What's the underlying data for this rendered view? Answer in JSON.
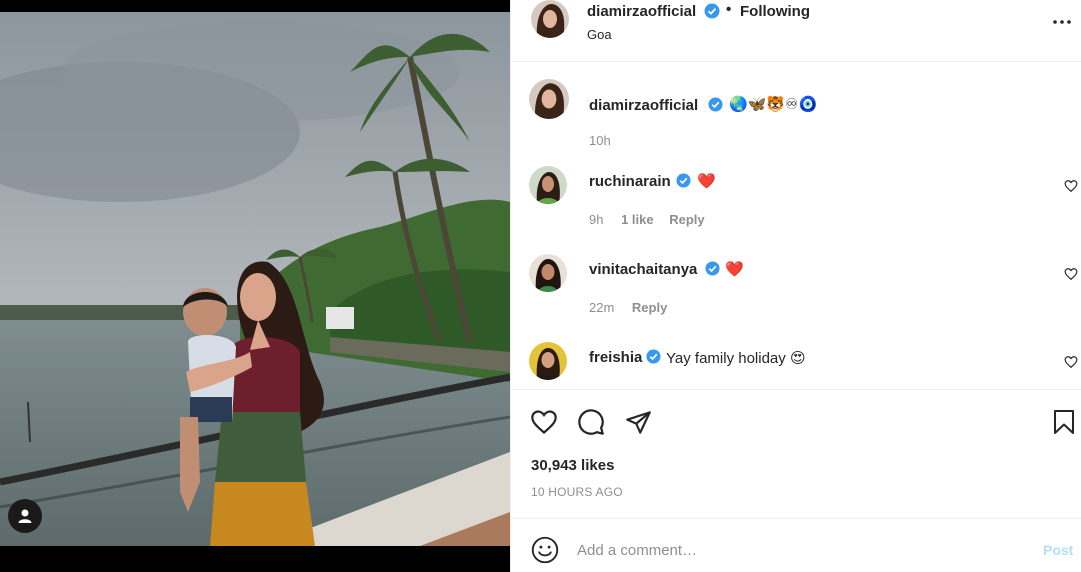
{
  "header": {
    "username": "diamirzaofficial",
    "separator": "•",
    "follow_status": "Following",
    "location": "Goa",
    "more_icon": "more-horizontal-icon"
  },
  "caption": {
    "username": "diamirzaofficial",
    "emojis": "🌏🦋🐯♾🧿",
    "time": "10h"
  },
  "comments": [
    {
      "username": "ruchinarain",
      "text": "❤️",
      "time": "9h",
      "likes": "1 like",
      "reply": "Reply"
    },
    {
      "username": "vinitachaitanya",
      "text": "❤️",
      "time": "22m",
      "likes": "",
      "reply": "Reply"
    },
    {
      "username": "freishia",
      "text": "Yay family holiday 😍",
      "time": "",
      "likes": "",
      "reply": ""
    }
  ],
  "actions": {
    "like_icon": "heart-icon",
    "comment_icon": "comment-icon",
    "share_icon": "paper-plane-icon",
    "save_icon": "bookmark-icon"
  },
  "likes_text": "30,943 likes",
  "timestamp": "10 HOURS AGO",
  "add_comment": {
    "placeholder": "Add a comment…",
    "post_label": "Post",
    "emoji_icon": "smiley-icon"
  },
  "colors": {
    "verified": "#3897f0",
    "text": "#262626",
    "secondary": "#8e8e8e",
    "post_disabled": "#b2dffc",
    "heart_red": "#ed1c24"
  }
}
